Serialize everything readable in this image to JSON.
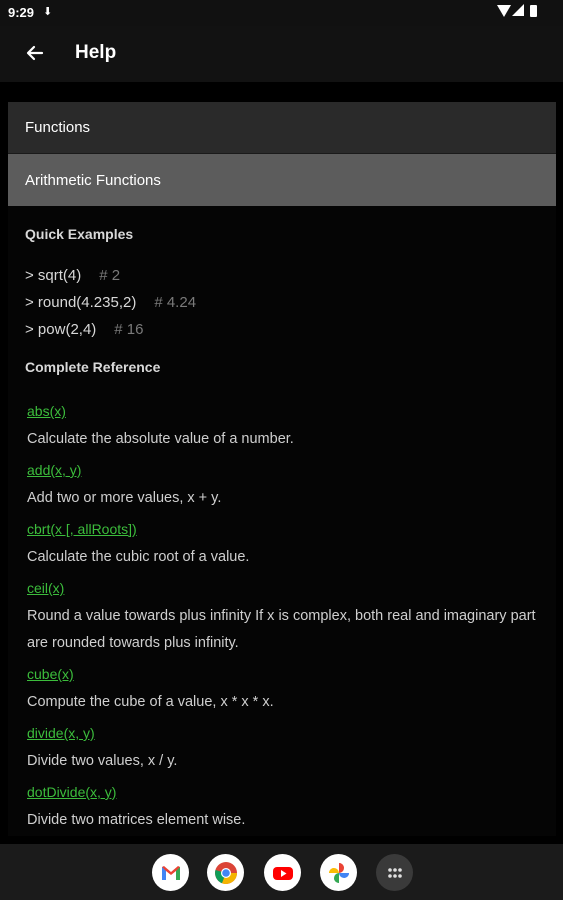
{
  "status_bar": {
    "time": "9:29",
    "indicator_icon": "download-icon"
  },
  "app_bar": {
    "back_icon": "arrow-left-icon",
    "title": "Help"
  },
  "sections": {
    "functions_label": "Functions",
    "arithmetic_label": "Arithmetic Functions"
  },
  "quick_examples": {
    "heading": "Quick Examples",
    "items": [
      {
        "code": "> sqrt(4)",
        "comment": "# 2"
      },
      {
        "code": "> round(4.235,2)",
        "comment": "# 4.24"
      },
      {
        "code": "> pow(2,4)",
        "comment": "# 16"
      }
    ]
  },
  "reference": {
    "heading": "Complete Reference",
    "items": [
      {
        "name": "abs(x)",
        "description": "Calculate the absolute value of a number."
      },
      {
        "name": "add(x, y)",
        "description": "Add two or more values, x + y."
      },
      {
        "name": "cbrt(x [, allRoots])",
        "description": "Calculate the cubic root of a value."
      },
      {
        "name": "ceil(x)",
        "description": "Round a value towards plus infinity If x is complex, both real and imaginary part are rounded towards plus infinity."
      },
      {
        "name": "cube(x)",
        "description": "Compute the cube of a value, x * x * x."
      },
      {
        "name": "divide(x, y)",
        "description": "Divide two values, x / y."
      },
      {
        "name": "dotDivide(x, y)",
        "description": "Divide two matrices element wise."
      }
    ]
  },
  "dock": {
    "apps": [
      {
        "name": "gmail-icon"
      },
      {
        "name": "chrome-icon"
      },
      {
        "name": "youtube-icon"
      },
      {
        "name": "photos-icon"
      },
      {
        "name": "app-drawer-icon"
      }
    ]
  },
  "colors": {
    "link": "#3cbd3c",
    "section_dark": "#2a2a2a",
    "section_selected": "#5c5c5c"
  }
}
